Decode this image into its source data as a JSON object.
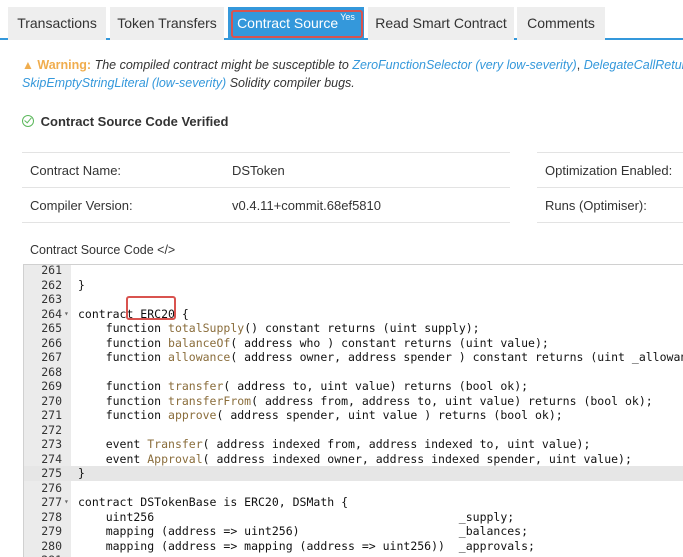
{
  "tabs": [
    {
      "label": "Transactions",
      "active": false
    },
    {
      "label": "Token Transfers",
      "active": false
    },
    {
      "label": "Contract Source",
      "badge": "Yes",
      "active": true
    },
    {
      "label": "Read Smart Contract",
      "active": false
    },
    {
      "label": "Comments",
      "active": false
    }
  ],
  "warning": {
    "icon": "warning-triangle-icon",
    "label": "Warning:",
    "text1": "The compiled contract might be susceptible to",
    "link1": "ZeroFunctionSelector (very low-severity)",
    "sep1": ",",
    "link2": "DelegateCallReturnValue",
    "link3": "SkipEmptyStringLiteral (low-severity)",
    "text2": "Solidity compiler bugs."
  },
  "verified": {
    "icon": "check-circle-icon",
    "text": "Contract Source Code Verified"
  },
  "info": {
    "contract_name_label": "Contract Name:",
    "contract_name": "DSToken",
    "compiler_label": "Compiler Version:",
    "compiler": "v0.4.11+commit.68ef5810",
    "optimization_label": "Optimization Enabled:",
    "runs_label": "Runs (Optimiser):"
  },
  "source_label": "Contract Source Code </>",
  "code_lines": [
    {
      "n": "261",
      "fold": "",
      "t": ""
    },
    {
      "n": "262",
      "fold": "",
      "t": "}"
    },
    {
      "n": "263",
      "fold": "",
      "t": ""
    },
    {
      "n": "264",
      "fold": "▾",
      "t": "contract ERC20 {"
    },
    {
      "n": "265",
      "fold": "",
      "t": "    function totalSupply() constant returns (uint supply);"
    },
    {
      "n": "266",
      "fold": "",
      "t": "    function balanceOf( address who ) constant returns (uint value);"
    },
    {
      "n": "267",
      "fold": "",
      "t": "    function allowance( address owner, address spender ) constant returns (uint _allowance);"
    },
    {
      "n": "268",
      "fold": "",
      "t": ""
    },
    {
      "n": "269",
      "fold": "",
      "t": "    function transfer( address to, uint value) returns (bool ok);"
    },
    {
      "n": "270",
      "fold": "",
      "t": "    function transferFrom( address from, address to, uint value) returns (bool ok);"
    },
    {
      "n": "271",
      "fold": "",
      "t": "    function approve( address spender, uint value ) returns (bool ok);"
    },
    {
      "n": "272",
      "fold": "",
      "t": ""
    },
    {
      "n": "273",
      "fold": "",
      "t": "    event Transfer( address indexed from, address indexed to, uint value);"
    },
    {
      "n": "274",
      "fold": "",
      "t": "    event Approval( address indexed owner, address indexed spender, uint value);"
    },
    {
      "n": "275",
      "fold": "",
      "t": "}",
      "highlight": true
    },
    {
      "n": "276",
      "fold": "",
      "t": ""
    },
    {
      "n": "277",
      "fold": "▾",
      "t": "contract DSTokenBase is ERC20, DSMath {"
    },
    {
      "n": "278",
      "fold": "",
      "t": "    uint256                                            _supply;"
    },
    {
      "n": "279",
      "fold": "",
      "t": "    mapping (address => uint256)                       _balances;"
    },
    {
      "n": "280",
      "fold": "",
      "t": "    mapping (address => mapping (address => uint256))  _approvals;"
    },
    {
      "n": "281",
      "fold": "",
      "t": ""
    }
  ],
  "colors": {
    "accent": "#3498db",
    "highlight_box": "#d9534f",
    "warning": "#f0ad4e",
    "verified": "#5cb85c"
  }
}
